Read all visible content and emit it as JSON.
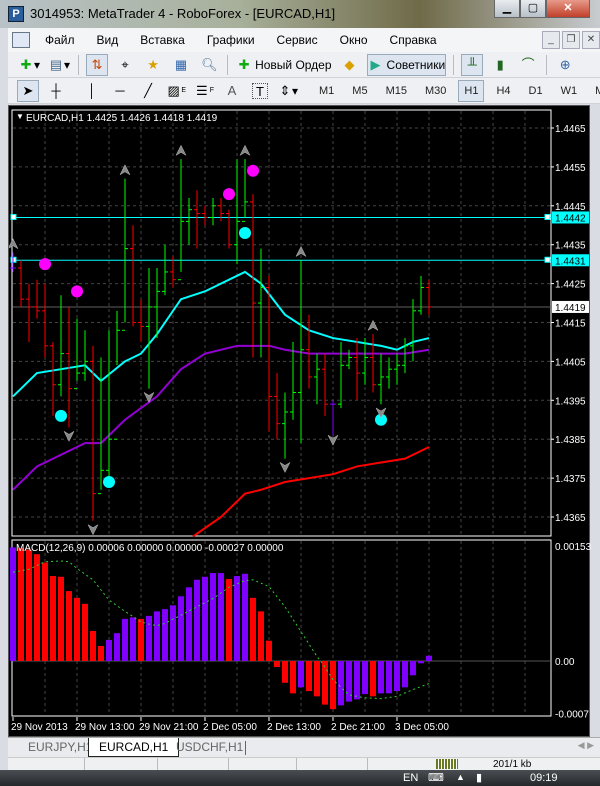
{
  "window": {
    "title": "3014953: MetaTrader 4 - RoboForex - [EURCAD,H1]"
  },
  "menu": [
    "Файл",
    "Вид",
    "Вставка",
    "Графики",
    "Сервис",
    "Окно",
    "Справка"
  ],
  "toolbar": {
    "new_order": "Новый Ордер",
    "experts": "Советники"
  },
  "draw_tools": {
    "text_tool": "A",
    "fibo_e": "E",
    "fibo_f": "F"
  },
  "timeframes": [
    "M1",
    "M5",
    "M15",
    "M30",
    "H1",
    "H4",
    "D1",
    "W1",
    "MN"
  ],
  "active_timeframe": "H1",
  "chart": {
    "header": "EURCAD,H1  1.4425 1.4426 1.4418 1.4419",
    "price_ticks": [
      "1.4465",
      "1.4455",
      "1.4445",
      "1.4435",
      "1.4425",
      "1.4415",
      "1.4405",
      "1.4395",
      "1.4385",
      "1.4375",
      "1.4365"
    ],
    "hlines": [
      {
        "label": "1.4442",
        "price": 1.4442
      },
      {
        "label": "1.4431",
        "price": 1.4431
      }
    ],
    "bid": {
      "label": "1.4419",
      "price": 1.4419
    },
    "macd_header": "MACD(12,26,9) 0.00006 0.00000 0.00000 -0.00027 0.00000",
    "macd_ticks": [
      {
        "label": "0.00153",
        "v": 0.00153
      },
      {
        "label": "0.00",
        "v": 0
      },
      {
        "label": "-0.0007",
        "v": -0.0007
      }
    ],
    "time_labels": [
      {
        "label": "29 Nov 2013",
        "bar": 0
      },
      {
        "label": "29 Nov 13:00",
        "bar": 8
      },
      {
        "label": "29 Nov 21:00",
        "bar": 16
      },
      {
        "label": "2 Dec 05:00",
        "bar": 24
      },
      {
        "label": "2 Dec 13:00",
        "bar": 32
      },
      {
        "label": "2 Dec 21:00",
        "bar": 40
      },
      {
        "label": "3 Dec 05:00",
        "bar": 48
      }
    ],
    "colors": {
      "up": "#00ff00",
      "down": "#ff0000",
      "doji": "#8000ff",
      "ma_fast": "#00ffff",
      "ma_mid": "#9400d3",
      "ma_slow": "#ff0000",
      "macd_up": "#8000ff",
      "macd_down": "#ff0000",
      "signal": "#32cd32",
      "magenta": "#ff00ff",
      "cyan": "#00ffff"
    }
  },
  "chart_data": {
    "type": "ohlc",
    "bars_hlc": [
      [
        1.4433,
        1.4428,
        1.4429
      ],
      [
        1.4431,
        1.4419,
        1.4421
      ],
      [
        1.4425,
        1.441,
        1.4419
      ],
      [
        1.4426,
        1.4416,
        1.4418
      ],
      [
        1.4425,
        1.4406,
        1.4409
      ],
      [
        1.441,
        1.4391,
        1.4399
      ],
      [
        1.4422,
        1.4396,
        1.4407
      ],
      [
        1.4419,
        1.4388,
        1.4398
      ],
      [
        1.4416,
        1.44,
        1.4402
      ],
      [
        1.4413,
        1.44,
        1.4405
      ],
      [
        1.4409,
        1.4364,
        1.4371
      ],
      [
        1.4406,
        1.4372,
        1.4377
      ],
      [
        1.4413,
        1.4374,
        1.4385
      ],
      [
        1.4418,
        1.4404,
        1.4413
      ],
      [
        1.4452,
        1.4415,
        1.4434
      ],
      [
        1.444,
        1.4414,
        1.4415
      ],
      [
        1.4421,
        1.441,
        1.4414
      ],
      [
        1.4429,
        1.4398,
        1.4419
      ],
      [
        1.4429,
        1.4411,
        1.4423
      ],
      [
        1.4435,
        1.4422,
        1.4428
      ],
      [
        1.4432,
        1.4424,
        1.4426
      ],
      [
        1.4457,
        1.4428,
        1.4441
      ],
      [
        1.4447,
        1.4435,
        1.4444
      ],
      [
        1.4449,
        1.4434,
        1.4443
      ],
      [
        1.4445,
        1.444,
        1.4442
      ],
      [
        1.4447,
        1.444,
        1.4445
      ],
      [
        1.4447,
        1.4441,
        1.4443
      ],
      [
        1.4444,
        1.4434,
        1.4435
      ],
      [
        1.4457,
        1.443,
        1.4441
      ],
      [
        1.4457,
        1.4442,
        1.4446
      ],
      [
        1.4448,
        1.4406,
        1.442
      ],
      [
        1.4434,
        1.4406,
        1.4424
      ],
      [
        1.4427,
        1.4387,
        1.4396
      ],
      [
        1.4402,
        1.4385,
        1.4389
      ],
      [
        1.4397,
        1.438,
        1.4392
      ],
      [
        1.441,
        1.439,
        1.4397
      ],
      [
        1.4431,
        1.4384,
        1.4408
      ],
      [
        1.4417,
        1.4398,
        1.4401
      ],
      [
        1.4407,
        1.4394,
        1.4403
      ],
      [
        1.4407,
        1.4391,
        1.4394
      ],
      [
        1.4395,
        1.4386,
        1.4394
      ],
      [
        1.441,
        1.4393,
        1.4404
      ],
      [
        1.4408,
        1.4403,
        1.4406
      ],
      [
        1.4411,
        1.4395,
        1.4402
      ],
      [
        1.4411,
        1.4399,
        1.4406
      ],
      [
        1.4412,
        1.4397,
        1.4399
      ],
      [
        1.4407,
        1.4394,
        1.4401
      ],
      [
        1.4406,
        1.4398,
        1.4403
      ],
      [
        1.4407,
        1.4399,
        1.4404
      ],
      [
        1.4411,
        1.4402,
        1.4409
      ],
      [
        1.4421,
        1.4405,
        1.4418
      ],
      [
        1.4427,
        1.4417,
        1.4424
      ],
      [
        1.4426,
        1.4417,
        1.4419
      ]
    ],
    "ma_fast": [
      [
        0,
        1.4396
      ],
      [
        3,
        1.4402
      ],
      [
        6,
        1.4403
      ],
      [
        9,
        1.4404
      ],
      [
        11,
        1.44
      ],
      [
        14,
        1.4405
      ],
      [
        16,
        1.4407
      ],
      [
        18,
        1.4412
      ],
      [
        21,
        1.4421
      ],
      [
        24,
        1.4423
      ],
      [
        28,
        1.4427
      ],
      [
        29,
        1.4428
      ],
      [
        31,
        1.4425
      ],
      [
        34,
        1.4417
      ],
      [
        37,
        1.4413
      ],
      [
        40,
        1.4411
      ],
      [
        43,
        1.441
      ],
      [
        46,
        1.4409
      ],
      [
        48,
        1.4408
      ],
      [
        50,
        1.441
      ],
      [
        52,
        1.4411
      ]
    ],
    "ma_mid": [
      [
        0,
        1.4372
      ],
      [
        3,
        1.4378
      ],
      [
        6,
        1.4381
      ],
      [
        9,
        1.4384
      ],
      [
        11,
        1.4384
      ],
      [
        14,
        1.439
      ],
      [
        18,
        1.4396
      ],
      [
        21,
        1.4403
      ],
      [
        24,
        1.4407
      ],
      [
        28,
        1.4409
      ],
      [
        30,
        1.4409
      ],
      [
        32,
        1.4409
      ],
      [
        34,
        1.4408
      ],
      [
        37,
        1.4407
      ],
      [
        40,
        1.4407
      ],
      [
        46,
        1.4407
      ],
      [
        49,
        1.4407
      ],
      [
        52,
        1.4408
      ]
    ],
    "ma_slow": [
      [
        22.5,
        1.436
      ],
      [
        26,
        1.4365
      ],
      [
        29,
        1.4371
      ],
      [
        31,
        1.4372
      ],
      [
        34,
        1.4374
      ],
      [
        37,
        1.4375
      ],
      [
        40,
        1.4376
      ],
      [
        43,
        1.4378
      ],
      [
        46,
        1.4379
      ],
      [
        49,
        1.438
      ],
      [
        52,
        1.4383
      ]
    ],
    "dots": [
      {
        "bar": 4,
        "p": 1.443,
        "c": "magenta"
      },
      {
        "bar": 8,
        "p": 1.4423,
        "c": "magenta"
      },
      {
        "bar": 27,
        "p": 1.4448,
        "c": "magenta"
      },
      {
        "bar": 30,
        "p": 1.4454,
        "c": "magenta"
      },
      {
        "bar": 6,
        "p": 1.4391,
        "c": "cyan"
      },
      {
        "bar": 12,
        "p": 1.4374,
        "c": "cyan"
      },
      {
        "bar": 29,
        "p": 1.4438,
        "c": "cyan"
      },
      {
        "bar": 46,
        "p": 1.439,
        "c": "cyan"
      }
    ],
    "arrows_up": [
      [
        0,
        1.4435
      ],
      [
        14,
        1.4454
      ],
      [
        21,
        1.4459
      ],
      [
        29,
        1.4459
      ],
      [
        36,
        1.4433
      ],
      [
        45,
        1.4414
      ]
    ],
    "arrows_down": [
      [
        7,
        1.4386
      ],
      [
        10,
        1.4362
      ],
      [
        17,
        1.4396
      ],
      [
        34,
        1.4378
      ],
      [
        40,
        1.4385
      ],
      [
        46,
        1.4392
      ]
    ],
    "macd_hist": [
      0.00151,
      0.0015,
      0.00148,
      0.00142,
      0.00131,
      0.00113,
      0.00112,
      0.00093,
      0.00084,
      0.00076,
      0.0004,
      0.0002,
      0.00028,
      0.00037,
      0.00056,
      0.00058,
      0.00056,
      0.0006,
      0.00066,
      0.00069,
      0.00074,
      0.00086,
      0.00098,
      0.00108,
      0.00112,
      0.00117,
      0.00117,
      0.00109,
      0.00113,
      0.00116,
      0.00084,
      0.00066,
      0.00027,
      -8e-05,
      -0.00029,
      -0.00043,
      -0.00035,
      -0.0004,
      -0.00047,
      -0.00058,
      -0.00064,
      -0.00059,
      -0.00054,
      -0.00051,
      -0.00044,
      -0.00047,
      -0.00043,
      -0.00043,
      -0.0004,
      -0.00035,
      -0.00019,
      -3e-05,
      7e-05
    ],
    "macd_signal": [
      [
        0,
        0.00118
      ],
      [
        2,
        0.00122
      ],
      [
        4,
        0.00132
      ],
      [
        6,
        0.00133
      ],
      [
        7,
        0.00132
      ],
      [
        8,
        0.00123
      ],
      [
        10,
        0.00108
      ],
      [
        12,
        0.00081
      ],
      [
        14,
        0.00066
      ],
      [
        16,
        0.00052
      ],
      [
        17,
        0.00049
      ],
      [
        18,
        0.00047
      ],
      [
        19,
        0.0005
      ],
      [
        21,
        0.00061
      ],
      [
        23,
        0.00072
      ],
      [
        25,
        0.00083
      ],
      [
        27,
        0.00098
      ],
      [
        29,
        0.00107
      ],
      [
        30,
        0.00108
      ],
      [
        32,
        0.00099
      ],
      [
        34,
        0.00072
      ],
      [
        36,
        0.00039
      ],
      [
        38,
        6e-05
      ],
      [
        39,
        -8e-05
      ],
      [
        40,
        -0.00025
      ],
      [
        42,
        -0.00045
      ],
      [
        44,
        -0.00049
      ],
      [
        46,
        -0.0005
      ],
      [
        48,
        -0.00047
      ],
      [
        50,
        -0.00038
      ],
      [
        52,
        -0.0003
      ]
    ]
  },
  "tabs": [
    "EURJPY,H1",
    "EURCAD,H1",
    "USDCHF,H1"
  ],
  "status": {
    "traffic": "201/1 kb"
  },
  "taskbar": {
    "lang": "EN",
    "clock": "09:19"
  }
}
